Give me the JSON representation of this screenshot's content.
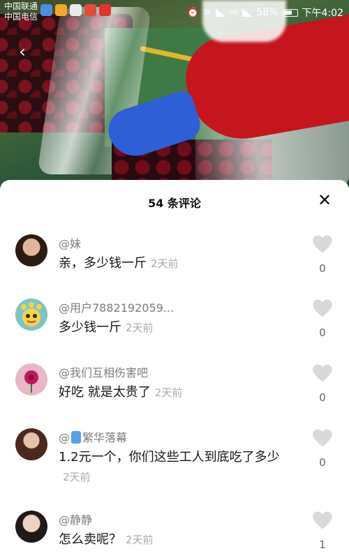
{
  "status_bar": {
    "carrier_line1": "中国联通",
    "carrier_line2": "中国电信",
    "network_label": "4G",
    "battery": "58%",
    "time": "下午4:02"
  },
  "sheet": {
    "title": "54 条评论"
  },
  "comments": [
    {
      "username": "@妹",
      "text": "亲，多少钱一斤",
      "time": "2天前",
      "likes": "0"
    },
    {
      "username": "@用户7882192059...",
      "text": "多少钱一斤",
      "time": "2天前",
      "likes": "0"
    },
    {
      "username": "@我们互相伤害吧",
      "text": "好吃 就是太贵了",
      "time": "2天前",
      "likes": "0"
    },
    {
      "username": "繁华落幕",
      "text": "1.2元一个，你们这些工人到底吃了多少",
      "time": "2天前",
      "likes": "0"
    },
    {
      "username": "@静静",
      "text": "怎么卖呢？",
      "time": "2天前",
      "likes": "1"
    }
  ],
  "colors": {
    "accent_red": "#c4161c",
    "like_gray": "#d9d9d9"
  },
  "icons": [
    "back-arrow-icon",
    "wifi-icon",
    "signal-icon",
    "battery-icon",
    "alarm-icon",
    "close-icon",
    "heart-icon"
  ]
}
